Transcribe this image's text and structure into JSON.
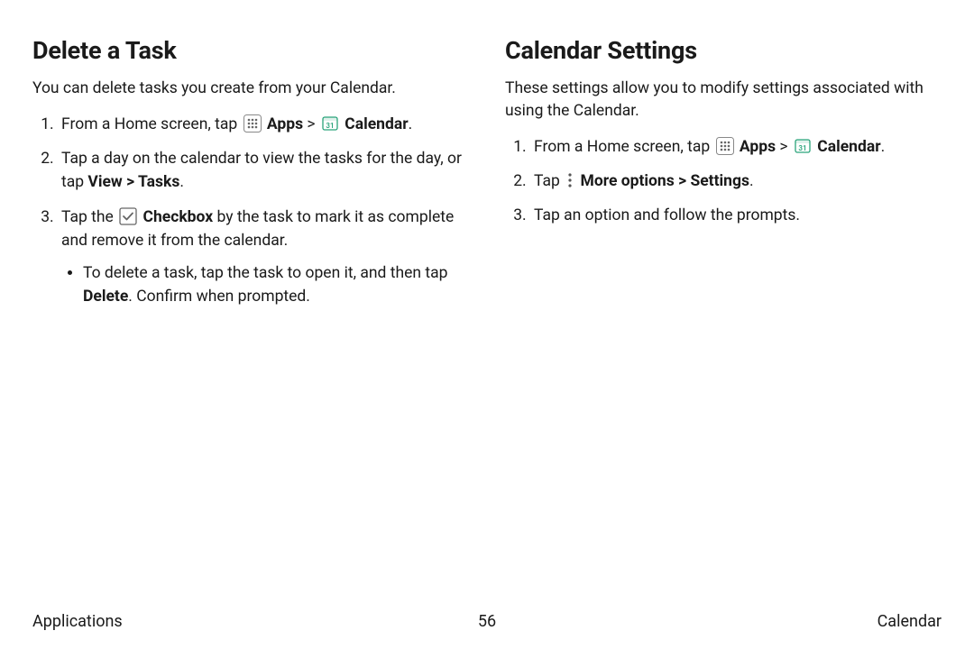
{
  "left": {
    "heading": "Delete a Task",
    "intro": "You can delete tasks you create from your Calendar.",
    "step1_pre": "From a Home screen, tap ",
    "apps_bold": "Apps",
    "step1_sep": " > ",
    "calendar_bold": "Calendar",
    "step1_end": ".",
    "step2_pre": "Tap a day on the calendar to view the tasks for the day, or tap ",
    "step2_link": "View > Tasks",
    "step2_end": ".",
    "step3_pre": "Tap the ",
    "step3_chk": "Checkbox",
    "step3_post": " by the task to mark it as complete and remove it from the calendar.",
    "step3_b_pre": "To delete a task, tap the task to open it, and then tap ",
    "step3_b_del": "Delete",
    "step3_b_post": ". Confirm when prompted."
  },
  "right": {
    "heading": "Calendar Settings",
    "intro": "These settings allow you to modify settings associated with using the Calendar.",
    "step1_pre": "From a Home screen, tap ",
    "apps_bold": "Apps",
    "step1_sep": " > ",
    "calendar_bold": "Calendar",
    "step1_end": ".",
    "step2_pre": "Tap ",
    "step2_more": "More options",
    "step2_sep": " > ",
    "step2_set": "Settings",
    "step2_end": ".",
    "step3": "Tap an option and follow the prompts."
  },
  "footer": {
    "left": "Applications",
    "page": "56",
    "right": "Calendar"
  }
}
